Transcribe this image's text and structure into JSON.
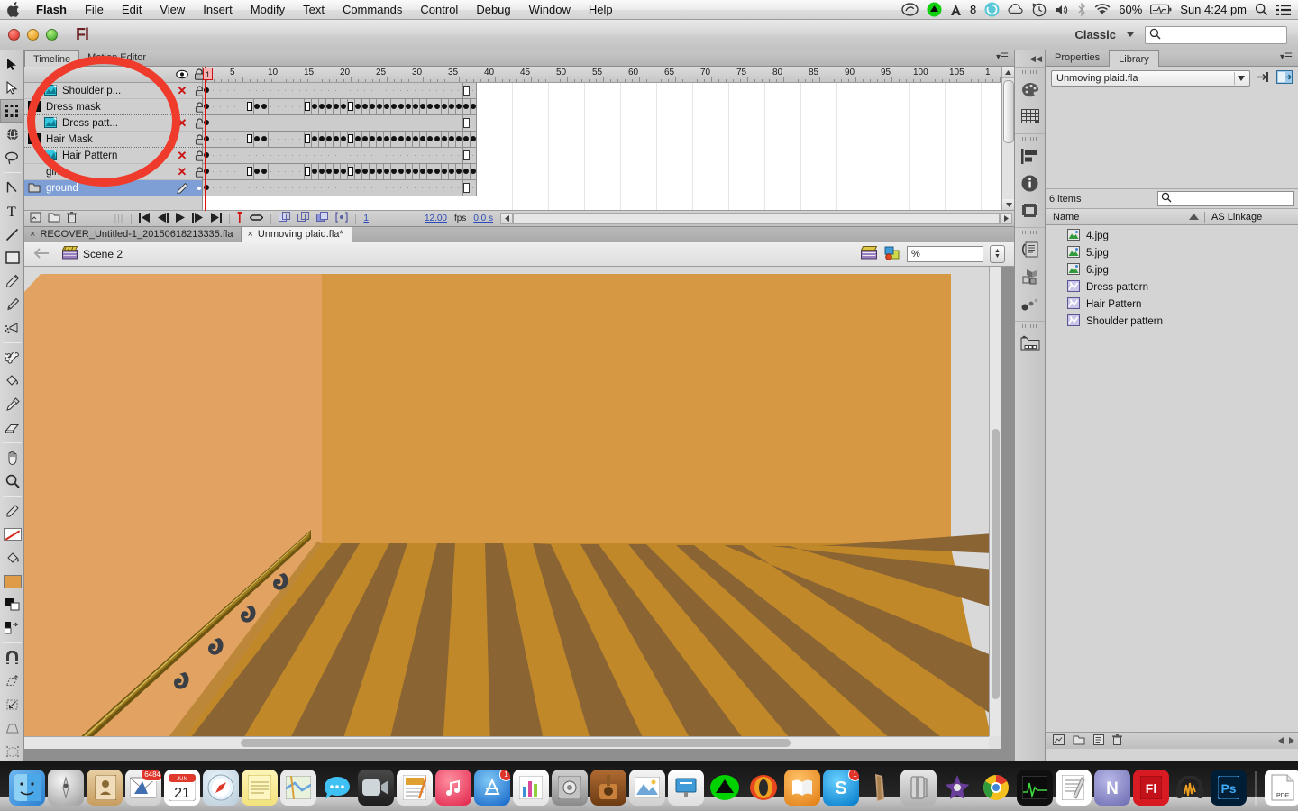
{
  "menubar": {
    "apple_icon": "apple-logo",
    "items": [
      {
        "label": "Flash",
        "bold": true
      },
      {
        "label": "File",
        "bold": false
      },
      {
        "label": "Edit",
        "bold": false
      },
      {
        "label": "View",
        "bold": false
      },
      {
        "label": "Insert",
        "bold": false
      },
      {
        "label": "Modify",
        "bold": false
      },
      {
        "label": "Text",
        "bold": false
      },
      {
        "label": "Commands",
        "bold": false
      },
      {
        "label": "Control",
        "bold": false
      },
      {
        "label": "Debug",
        "bold": false
      },
      {
        "label": "Window",
        "bold": false
      },
      {
        "label": "Help",
        "bold": false
      }
    ],
    "status": {
      "creative_cloud_icon": "creative-cloud-icon",
      "dropbox_icon": "green-drop-icon",
      "adobe_badge": "adobe-a-icon",
      "adobe_count": "8",
      "sync_icon": "sync-circle-icon",
      "cloud_icon": "cloud-icon",
      "timemachine_icon": "time-machine-icon",
      "volume_icon": "volume-icon",
      "bluetooth_icon": "bluetooth-icon",
      "wifi_icon": "wifi-icon",
      "battery_percent": "60%",
      "battery_icon": "battery-icon",
      "clock": "Sun 4:24 pm",
      "spotlight_icon": "search-icon",
      "notification_icon": "notification-center-icon"
    }
  },
  "apptitle": {
    "app_logo": "Fl",
    "workspace": "Classic",
    "search_placeholder": "",
    "search_value": "",
    "search_icon": "search-icon"
  },
  "tools": [
    {
      "name": "selection-tool",
      "icon": "arrow-black-icon",
      "selected": false
    },
    {
      "name": "subselection-tool",
      "icon": "arrow-white-icon",
      "selected": false
    },
    {
      "name": "free-transform-tool",
      "icon": "free-transform-icon",
      "selected": true
    },
    {
      "name": "3d-rotation-tool",
      "icon": "sphere-icon",
      "selected": false
    },
    {
      "name": "lasso-tool",
      "icon": "lasso-icon",
      "selected": false
    },
    {
      "name": "pen-tool",
      "icon": "pen-icon",
      "selected": false
    },
    {
      "name": "text-tool",
      "icon": "text-t-icon",
      "selected": false
    },
    {
      "name": "line-tool",
      "icon": "line-icon",
      "selected": false
    },
    {
      "name": "rectangle-tool",
      "icon": "rectangle-icon",
      "selected": false
    },
    {
      "name": "pencil-tool",
      "icon": "pencil-icon",
      "selected": false
    },
    {
      "name": "brush-tool",
      "icon": "brush-icon",
      "selected": false
    },
    {
      "name": "spray-brush-tool",
      "icon": "spray-icon",
      "selected": false
    },
    {
      "name": "bone-tool",
      "icon": "bone-icon",
      "selected": false
    },
    {
      "name": "paint-bucket-tool",
      "icon": "paint-bucket-icon",
      "selected": false
    },
    {
      "name": "eyedropper-tool",
      "icon": "eyedropper-icon",
      "selected": false
    },
    {
      "name": "eraser-tool",
      "icon": "eraser-icon",
      "selected": false
    },
    {
      "name": "hand-tool",
      "icon": "hand-icon",
      "selected": false
    },
    {
      "name": "zoom-tool",
      "icon": "magnifier-icon",
      "selected": false
    },
    {
      "name": "stroke-color-tool",
      "icon": "eyedropper-small-icon",
      "selected": false
    }
  ],
  "tool_colors": {
    "stroke_label": "stroke-color-none",
    "fill_color": "#de9b48",
    "black-white-icon": "black-and-white-icon",
    "swap-icon": "swap-colors-icon"
  },
  "tool_options": [
    {
      "name": "snap-to-objects-option",
      "icon": "magnet-icon"
    },
    {
      "name": "rotate-option",
      "icon": "rotate-icon"
    },
    {
      "name": "scale-option",
      "icon": "scale-icon"
    },
    {
      "name": "distort-option",
      "icon": "distort-icon"
    },
    {
      "name": "envelope-option",
      "icon": "envelope-icon"
    }
  ],
  "timeline": {
    "tabs": [
      {
        "label": "Timeline",
        "active": true
      },
      {
        "label": "Motion Editor",
        "active": false
      }
    ],
    "panel_menu_icon": "panel-menu-icon",
    "header_icons": {
      "eye": "eye-icon",
      "lock": "lock-icon",
      "outline": "outline-square-icon"
    },
    "ruler_labels": [
      "1",
      "5",
      "10",
      "15",
      "20",
      "25",
      "30",
      "35",
      "40",
      "45",
      "50",
      "55",
      "60",
      "65",
      "70",
      "75",
      "80",
      "85",
      "90",
      "95",
      "100",
      "105",
      "1"
    ],
    "playhead_frame": "1",
    "layers": [
      {
        "name": "Shoulder p...",
        "icon": "masked-layer-icon",
        "indent": true,
        "visible": false,
        "locked": true,
        "color": "#a13ad6",
        "selected": false,
        "type": "masked"
      },
      {
        "name": "Dress mask",
        "icon": "mask-layer-icon",
        "indent": false,
        "visible": true,
        "locked": true,
        "color": "#8a8a8a",
        "selected": false,
        "type": "mask"
      },
      {
        "name": "Dress patt...",
        "icon": "masked-layer-icon",
        "indent": true,
        "visible": false,
        "locked": true,
        "color": "#5577e0",
        "selected": false,
        "type": "masked"
      },
      {
        "name": "Hair Mask",
        "icon": "mask-layer-icon",
        "indent": false,
        "visible": true,
        "locked": true,
        "color": "#ee18d5",
        "selected": false,
        "type": "mask"
      },
      {
        "name": "Hair Pattern",
        "icon": "masked-layer-icon",
        "indent": true,
        "visible": false,
        "locked": true,
        "color": "#31e2ea",
        "selected": false,
        "type": "masked"
      },
      {
        "name": "girl",
        "icon": "normal-layer-icon",
        "indent": false,
        "visible": false,
        "locked": true,
        "color": "#24e363",
        "selected": false,
        "type": "normal"
      },
      {
        "name": "ground",
        "icon": "folder-layer-icon",
        "indent": false,
        "visible": true,
        "locked": false,
        "color": "#e8872a",
        "selected": true,
        "type": "normal"
      }
    ],
    "status": {
      "new_layer_icon": "new-layer-icon",
      "new_folder_icon": "new-folder-icon",
      "delete_icon": "trash-icon",
      "goto_first_icon": "go-to-first-frame-icon",
      "step_back_icon": "step-back-icon",
      "play_icon": "play-icon",
      "step_fwd_icon": "step-forward-icon",
      "goto_last_icon": "go-to-last-frame-icon",
      "center_frame_icon": "center-frame-icon",
      "loop_icon": "loop-icon",
      "onion_skin_icon": "onion-skin-icon",
      "onion_outline_icon": "onion-skin-outline-icon",
      "edit_multiple_icon": "edit-multiple-frames-icon",
      "modify_markers_icon": "modify-onion-markers-icon",
      "current_frame": "1",
      "fps_value": "12.00",
      "fps_label": "fps",
      "elapsed": "0.0 s"
    }
  },
  "doctabs": [
    {
      "label": "RECOVER_Untitled-1_20150618213335.fla",
      "active": false,
      "close_icon": "close-icon"
    },
    {
      "label": "Unmoving plaid.fla*",
      "active": true,
      "close_icon": "close-icon"
    }
  ],
  "editbar": {
    "back_icon": "back-arrow-icon",
    "scene_icon": "scene-clapboard-icon",
    "scene_name": "Scene 2",
    "edit_scene_icon": "edit-scene-icon",
    "edit_symbols_icon": "edit-symbols-icon",
    "zoom_value": "%",
    "zoom_stepper_icon": "stepper-icon"
  },
  "rail_buttons": [
    {
      "name": "color-panel-button",
      "icon": "palette-icon"
    },
    {
      "name": "swatches-panel-button",
      "icon": "swatches-grid-icon"
    },
    {
      "name": "align-panel-button",
      "icon": "align-icon"
    },
    {
      "name": "info-panel-button",
      "icon": "info-circle-icon"
    },
    {
      "name": "transform-panel-button",
      "icon": "transform-icon"
    },
    {
      "name": "code-snippets-button",
      "icon": "code-snippets-icon"
    },
    {
      "name": "components-panel-button",
      "icon": "components-cubes-icon"
    },
    {
      "name": "motion-presets-button",
      "icon": "motion-presets-icon"
    },
    {
      "name": "library-panel-button",
      "icon": "library-folder-icon"
    }
  ],
  "library": {
    "tabs": [
      {
        "label": "Properties",
        "active": false
      },
      {
        "label": "Library",
        "active": true
      }
    ],
    "panel_menu_icon": "panel-menu-icon",
    "document_select": "Unmoving plaid.fla",
    "dropdown_icon": "chevron-down-icon",
    "pin_icon": "pin-library-icon",
    "new_library_icon": "new-library-panel-icon",
    "item_count": "6 items",
    "search_placeholder": "",
    "search_icon": "search-icon",
    "columns": {
      "name": "Name",
      "sort_icon": "sort-ascending-icon",
      "as_linkage": "AS Linkage"
    },
    "items": [
      {
        "name": "4.jpg",
        "icon": "bitmap-icon",
        "linkage": ""
      },
      {
        "name": "5.jpg",
        "icon": "bitmap-icon",
        "linkage": ""
      },
      {
        "name": "6.jpg",
        "icon": "bitmap-icon",
        "linkage": ""
      },
      {
        "name": "Dress pattern",
        "icon": "graphic-symbol-icon",
        "linkage": ""
      },
      {
        "name": "Hair Pattern",
        "icon": "graphic-symbol-icon",
        "linkage": ""
      },
      {
        "name": "Shoulder pattern",
        "icon": "graphic-symbol-icon",
        "linkage": ""
      }
    ],
    "footer_icons": [
      {
        "name": "new-symbol-button",
        "icon": "new-symbol-icon"
      },
      {
        "name": "new-folder-button",
        "icon": "new-folder-icon"
      },
      {
        "name": "properties-button",
        "icon": "properties-icon"
      },
      {
        "name": "delete-button",
        "icon": "trash-icon"
      }
    ]
  },
  "annotation": {
    "shape": "red-ellipse-highlight",
    "color": "#ef3b2c"
  },
  "stage": {
    "wall_left_color": "#e2a362",
    "wall_back_color": "#d79844",
    "floor_color": "#c08828",
    "floor_stripe_color": "#8a6433",
    "baseboard_color": "#b07d2c",
    "railing_color": "#8a6a16",
    "bracket_color": "#3a3f46",
    "background_color": "#d9d9d9"
  },
  "dock": {
    "items": [
      {
        "name": "finder",
        "badge": ""
      },
      {
        "name": "launchpad",
        "badge": ""
      },
      {
        "name": "contacts",
        "badge": ""
      },
      {
        "name": "mail",
        "badge": "6484"
      },
      {
        "name": "calendar",
        "badge": "",
        "day": "21",
        "month": "JUN"
      },
      {
        "name": "safari",
        "badge": ""
      },
      {
        "name": "notes",
        "badge": ""
      },
      {
        "name": "maps",
        "badge": ""
      },
      {
        "name": "messages",
        "badge": ""
      },
      {
        "name": "facetime",
        "badge": ""
      },
      {
        "name": "pages",
        "badge": ""
      },
      {
        "name": "itunes",
        "badge": ""
      },
      {
        "name": "app-store",
        "badge": "1"
      },
      {
        "name": "numbers",
        "badge": ""
      },
      {
        "name": "system-preferences",
        "badge": ""
      },
      {
        "name": "garageband",
        "badge": ""
      },
      {
        "name": "iphoto",
        "badge": ""
      },
      {
        "name": "keynote",
        "badge": ""
      },
      {
        "name": "dropbox",
        "badge": ""
      },
      {
        "name": "firefox",
        "badge": ""
      },
      {
        "name": "ibooks",
        "badge": ""
      },
      {
        "name": "skype",
        "badge": "1"
      },
      {
        "name": "cinema4d",
        "badge": ""
      },
      {
        "name": "stuffit",
        "badge": ""
      },
      {
        "name": "imovie",
        "badge": ""
      },
      {
        "name": "chrome",
        "badge": ""
      },
      {
        "name": "activity-monitor",
        "badge": ""
      },
      {
        "name": "textedit",
        "badge": ""
      },
      {
        "name": "onenote",
        "badge": ""
      },
      {
        "name": "flash",
        "badge": ""
      },
      {
        "name": "audacity",
        "badge": ""
      },
      {
        "name": "photoshop",
        "badge": ""
      }
    ],
    "stack_items": [
      {
        "name": "pdf-document",
        "label": "PDF"
      },
      {
        "name": "downloads-stack",
        "label": ""
      },
      {
        "name": "documents-stack",
        "label": ""
      }
    ],
    "trash": {
      "name": "trash",
      "label": ""
    }
  }
}
